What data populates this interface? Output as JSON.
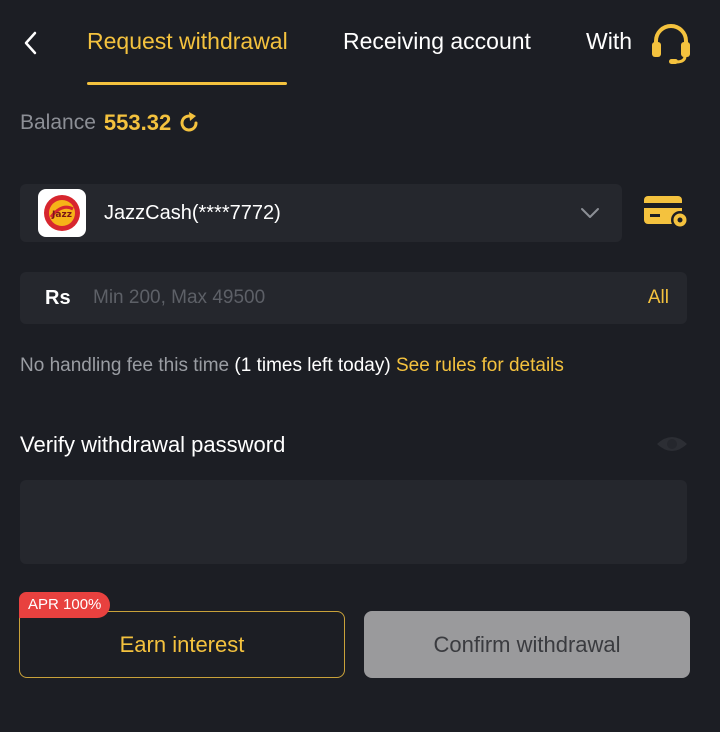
{
  "header": {
    "tabs": [
      {
        "label": "Request withdrawal",
        "active": true
      },
      {
        "label": "Receiving account",
        "active": false
      },
      {
        "label": "With",
        "active": false
      }
    ]
  },
  "balance": {
    "label": "Balance",
    "value": "553.32"
  },
  "account": {
    "name": "JazzCash(****7772)",
    "logo_text": "Jazz"
  },
  "amount": {
    "currency": "Rs",
    "placeholder": "Min 200, Max 49500",
    "all_label": "All"
  },
  "fee": {
    "text": "No handling fee this time",
    "count": "(1 times left today)",
    "link": "See rules for details"
  },
  "password": {
    "title": "Verify withdrawal password",
    "value": ""
  },
  "actions": {
    "apr_badge": "APR 100%",
    "earn_label": "Earn interest",
    "confirm_label": "Confirm withdrawal"
  },
  "colors": {
    "background": "#1c1e24",
    "panel": "#25272d",
    "accent": "#f4c23e",
    "badge": "#e8413f",
    "disabled_button": "#9a9a9c"
  }
}
